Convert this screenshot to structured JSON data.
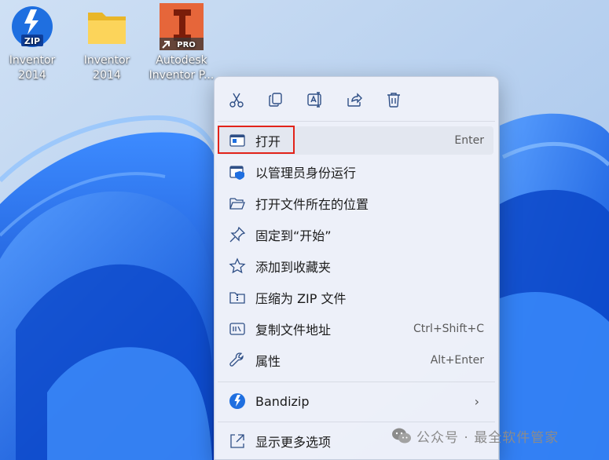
{
  "desktop": {
    "icons": [
      {
        "line1": "Inventor",
        "line2": "2014",
        "type": "zip",
        "badge": "ZIP"
      },
      {
        "line1": "Inventor",
        "line2": "2014",
        "type": "folder"
      },
      {
        "line1": "Autodesk",
        "line2": "Inventor P...",
        "type": "app",
        "badge": "PRO"
      }
    ]
  },
  "context_menu": {
    "toolbar": [
      {
        "id": "cut",
        "icon": "scissors-icon"
      },
      {
        "id": "copy",
        "icon": "copy-icon"
      },
      {
        "id": "rename",
        "icon": "rename-icon"
      },
      {
        "id": "share",
        "icon": "share-icon"
      },
      {
        "id": "delete",
        "icon": "trash-icon"
      }
    ],
    "items": [
      {
        "label": "打开",
        "shortcut": "Enter",
        "icon": "open-window-icon"
      },
      {
        "label": "以管理员身份运行",
        "shortcut": "",
        "icon": "admin-shield-icon"
      },
      {
        "label": "打开文件所在的位置",
        "shortcut": "",
        "icon": "folder-open-icon"
      },
      {
        "label": "固定到“开始”",
        "shortcut": "",
        "icon": "pin-icon"
      },
      {
        "label": "添加到收藏夹",
        "shortcut": "",
        "icon": "star-icon"
      },
      {
        "label": "压缩为 ZIP 文件",
        "shortcut": "",
        "icon": "zip-folder-icon"
      },
      {
        "label": "复制文件地址",
        "shortcut": "Ctrl+Shift+C",
        "icon": "copy-path-icon"
      },
      {
        "label": "属性",
        "shortcut": "Alt+Enter",
        "icon": "wrench-icon"
      },
      {
        "label": "Bandizip",
        "shortcut": "",
        "icon": "bandizip-icon",
        "submenu_arrow": "›"
      },
      {
        "label": "显示更多选项",
        "shortcut": "",
        "icon": "more-options-icon"
      }
    ]
  },
  "watermark": {
    "text": "公众号 · 最全软件管家",
    "icon": "wechat-icon"
  },
  "colors": {
    "accent_blue": "#1f6fe0",
    "highlight_red": "#e2231a",
    "autodesk_orange": "#e0542a"
  }
}
